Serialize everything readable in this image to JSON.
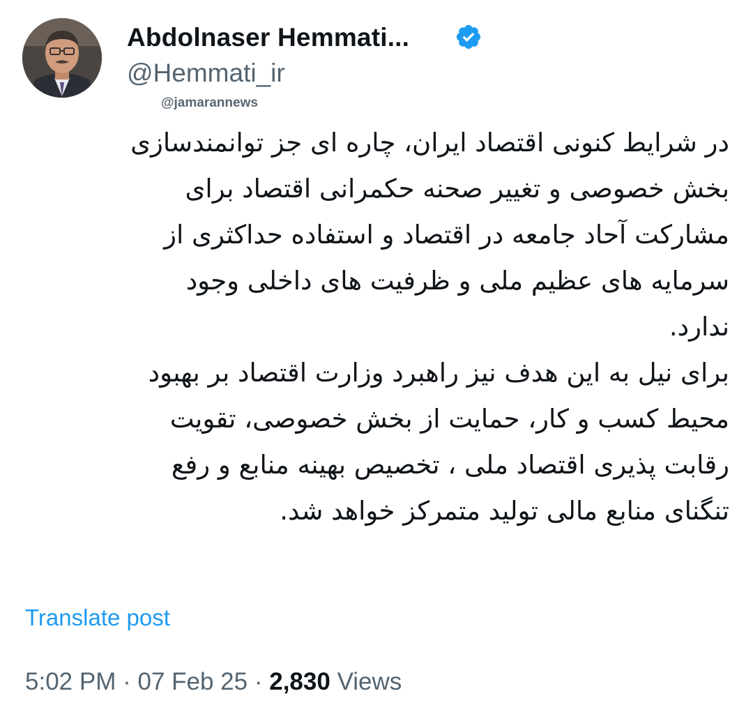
{
  "author": {
    "name": "Abdolnaser Hemmati...",
    "handle": "@Hemmati_ir",
    "verified": true,
    "verified_color": "#1d9bf0"
  },
  "watermark": "@jamarannews",
  "post": {
    "lines": [
      "در شرایط کنونی اقتصاد ایران،  چاره ای جز توانمندسازی",
      "بخش خصوصی و تغییر صحنه حکمرانی اقتصاد برای",
      "مشارکت آحاد جامعه در اقتصاد و استفاده حداکثری از",
      "سرمایه های عظیم ملی و ظرفیت های داخلی وجود",
      "ندارد.",
      "برای نیل به این هدف نیز راهبرد وزارت اقتصاد بر بهبود",
      "محیط کسب و کار، حمایت از بخش خصوصی، تقویت",
      "رقابت پذیری اقتصاد ملی ، تخصیص بهینه منابع و رفع",
      "تنگنای منابع مالی تولید متمرکز خواهد شد."
    ]
  },
  "translate_label": "Translate post",
  "meta": {
    "time": "5:02 PM",
    "separator": "·",
    "date": "07 Feb 25",
    "views_count": "2,830",
    "views_label": "Views"
  },
  "colors": {
    "text": "#0f1419",
    "secondary": "#536471",
    "link": "#1d9bf0"
  }
}
